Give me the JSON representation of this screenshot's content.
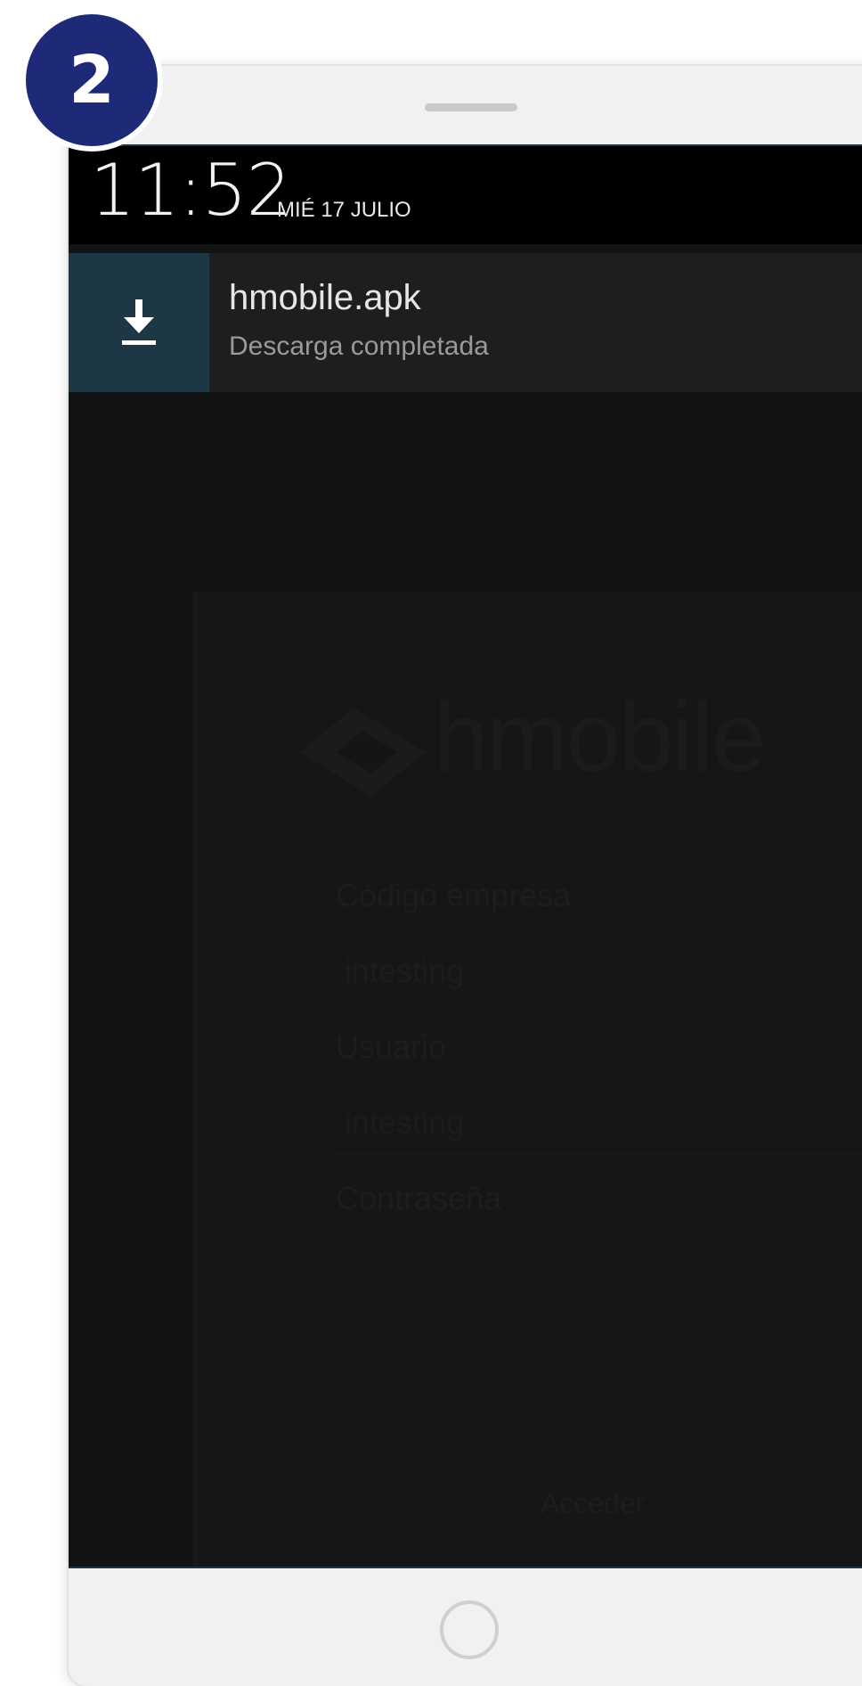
{
  "step": {
    "number": "2"
  },
  "status": {
    "time": "11:52",
    "date": "MIÉ 17 JULIO"
  },
  "notification": {
    "icon": "download-icon",
    "title": "hmobile.apk",
    "subtitle": "Descarga completada"
  },
  "background_app": {
    "logo_text": "hmobile",
    "fields": [
      {
        "label": "Código empresa",
        "value": "intesting"
      },
      {
        "label": "Usuario",
        "value": "intesting"
      },
      {
        "label": "Contraseña",
        "value": ""
      }
    ],
    "button_label": "Acceder"
  },
  "colors": {
    "badge": "#1e2a78",
    "notification_icon_bg": "#1e3744",
    "screen_bg": "#121416",
    "status_bar": "#000000"
  }
}
